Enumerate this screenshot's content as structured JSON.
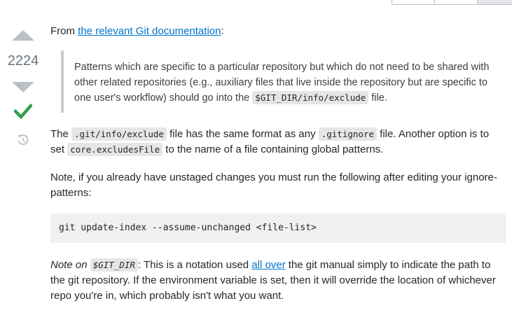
{
  "vote": {
    "count": "2224"
  },
  "answer": {
    "intro_prefix": "From ",
    "intro_link": "the relevant Git documentation",
    "intro_suffix": ":",
    "quote": {
      "text": "Patterns which are specific to a particular repository but which do not need to be shared with other related repositories (e.g., auxiliary files that live inside the repository but are specific to one user's workflow) should go into the ",
      "code": "$GIT_DIR/info/exclude",
      "suffix": " file."
    },
    "para2": {
      "t1": "The ",
      "c1": ".git/info/exclude",
      "t2": " file has the same format as any ",
      "c2": ".gitignore",
      "t3": " file. Another option is to set ",
      "c3": "core.excludesFile",
      "t4": " to the name of a file containing global patterns."
    },
    "para3": "Note, if you already have unstaged changes you must run the following after editing your ignore-patterns:",
    "code_block": "git update-index --assume-unchanged <file-list>",
    "para4": {
      "em_prefix": "Note on ",
      "em_code": "$GIT_DIR",
      "t1": ": This is a notation used ",
      "link": "all over",
      "t2": " the git manual simply to indicate the path to the git repository. If the environment variable is set, then it will override the location of whichever repo you're in, which probably isn't what you want."
    }
  },
  "icons": [
    "vote-up-icon",
    "vote-down-icon",
    "accepted-check-icon",
    "history-icon"
  ],
  "colors": {
    "link": "#0074cc",
    "accepted": "#2f9f4a",
    "vote_arrow": "#bbc0c4"
  }
}
